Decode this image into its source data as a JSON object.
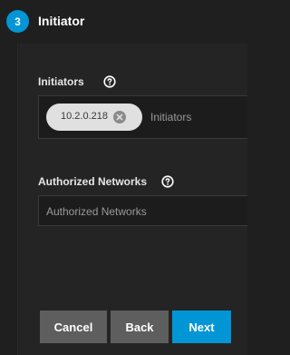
{
  "step": {
    "number": "3",
    "title": "Initiator"
  },
  "initiators": {
    "label": "Initiators",
    "chips": [
      "10.2.0.218"
    ],
    "placeholder": "Initiators"
  },
  "authorized_networks": {
    "label": "Authorized Networks",
    "placeholder": "Authorized Networks",
    "value": ""
  },
  "buttons": {
    "cancel": "Cancel",
    "back": "Back",
    "next": "Next"
  },
  "colors": {
    "accent": "#0095d5",
    "background": "#1f1f1f",
    "panel": "#242424",
    "button_secondary": "#5e5e5e"
  },
  "icons": {
    "help": "help-circle-icon",
    "chip_remove": "close-circle-icon"
  }
}
